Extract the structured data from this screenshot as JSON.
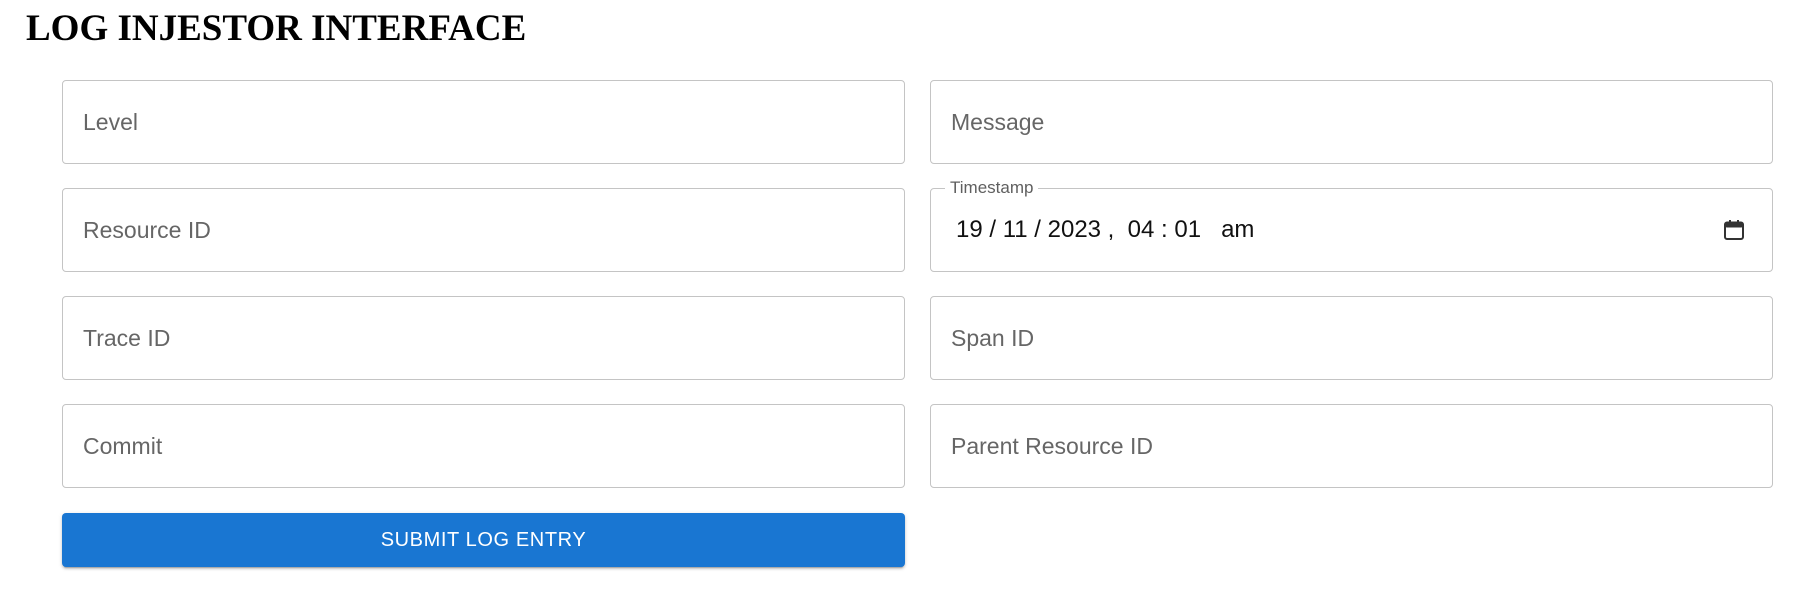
{
  "header": {
    "title": "LOG INJESTOR INTERFACE"
  },
  "form": {
    "level": {
      "placeholder": "Level",
      "value": ""
    },
    "message": {
      "placeholder": "Message",
      "value": ""
    },
    "resource_id": {
      "placeholder": "Resource ID",
      "value": ""
    },
    "timestamp": {
      "label": "Timestamp",
      "value": "19 / 11 / 2023 ,  04 : 01   am",
      "icon": "calendar-icon"
    },
    "trace_id": {
      "placeholder": "Trace ID",
      "value": ""
    },
    "span_id": {
      "placeholder": "Span ID",
      "value": ""
    },
    "commit": {
      "placeholder": "Commit",
      "value": ""
    },
    "parent_resource_id": {
      "placeholder": "Parent Resource ID",
      "value": ""
    },
    "submit_label": "SUBMIT LOG ENTRY"
  },
  "colors": {
    "primary": "#1976d2",
    "border": "#c4c4c4",
    "placeholder": "#666666"
  }
}
